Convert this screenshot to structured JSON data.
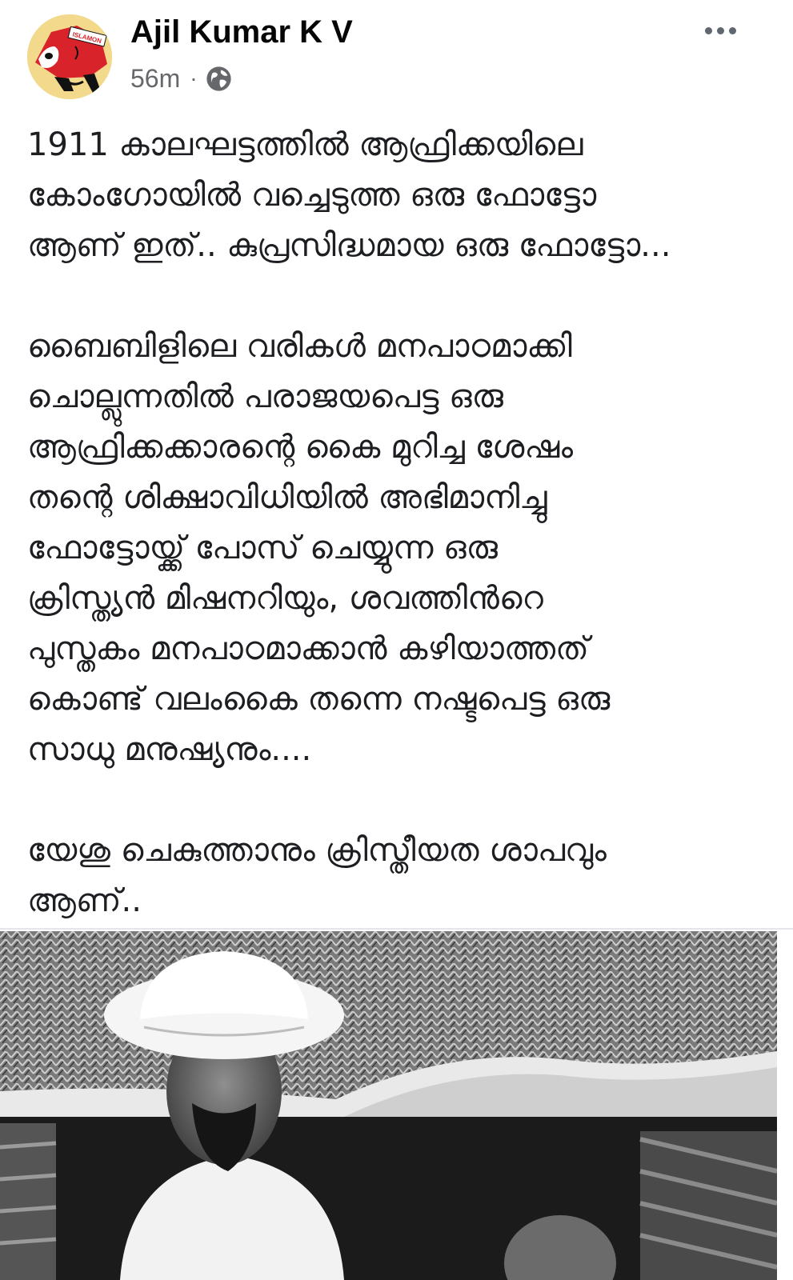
{
  "post": {
    "author": "Ajil Kumar K V",
    "time": "56m",
    "separator": "·",
    "privacy_icon": "globe-icon",
    "more_icon": "more-options-icon",
    "avatar_icon": "cartoon-avatar-icon",
    "avatar_text": "ISLAMON",
    "paragraphs": [
      {
        "lines": [
          "1911 കാലഘട്ടത്തിൽ ആഫ്രിക്കയിലെ",
          "കോംഗോയിൽ വച്ചെടുത്ത ഒരു ഫോട്ടോ",
          "ആണ് ഇത്.. കുപ്രസിദ്ധമായ ഒരു ഫോട്ടോ..."
        ]
      },
      {
        "lines": [
          "ബൈബിളിലെ വരികൾ മനപാഠമാക്കി",
          "ചൊല്ലുന്നതിൽ പരാജയപെട്ട ഒരു",
          "ആഫ്രിക്കക്കാരന്റെ കൈ മുറിച്ച ശേഷം",
          "തന്റെ ശിക്ഷാവിധിയിൽ അഭിമാനിച്ചു",
          "ഫോട്ടോയ്ക്ക് പോസ് ചെയ്യുന്ന ഒരു",
          "ക്രിസ്ത്യൻ മിഷനറിയും, ശവത്തിൻറെ",
          "പുസ്തകം മനപാഠമാക്കാൻ കഴിയാത്തത്",
          "കൊണ്ട് വലംകൈ തന്നെ നഷ്ടപെട്ട ഒരു",
          "സാധു മനുഷ്യനും...."
        ]
      },
      {
        "lines": [
          "യേശു ചെകുത്താനും ക്രിസ്തീയത ശാപവും",
          "ആണ്.."
        ]
      }
    ],
    "photo": {
      "description_icon": "black-and-white-photo",
      "colors": {
        "sky": "#d9d9d9",
        "thatch": "#6f6f6f",
        "shadow": "#1a1a1a",
        "clothing": "#f2f2f2"
      }
    }
  }
}
